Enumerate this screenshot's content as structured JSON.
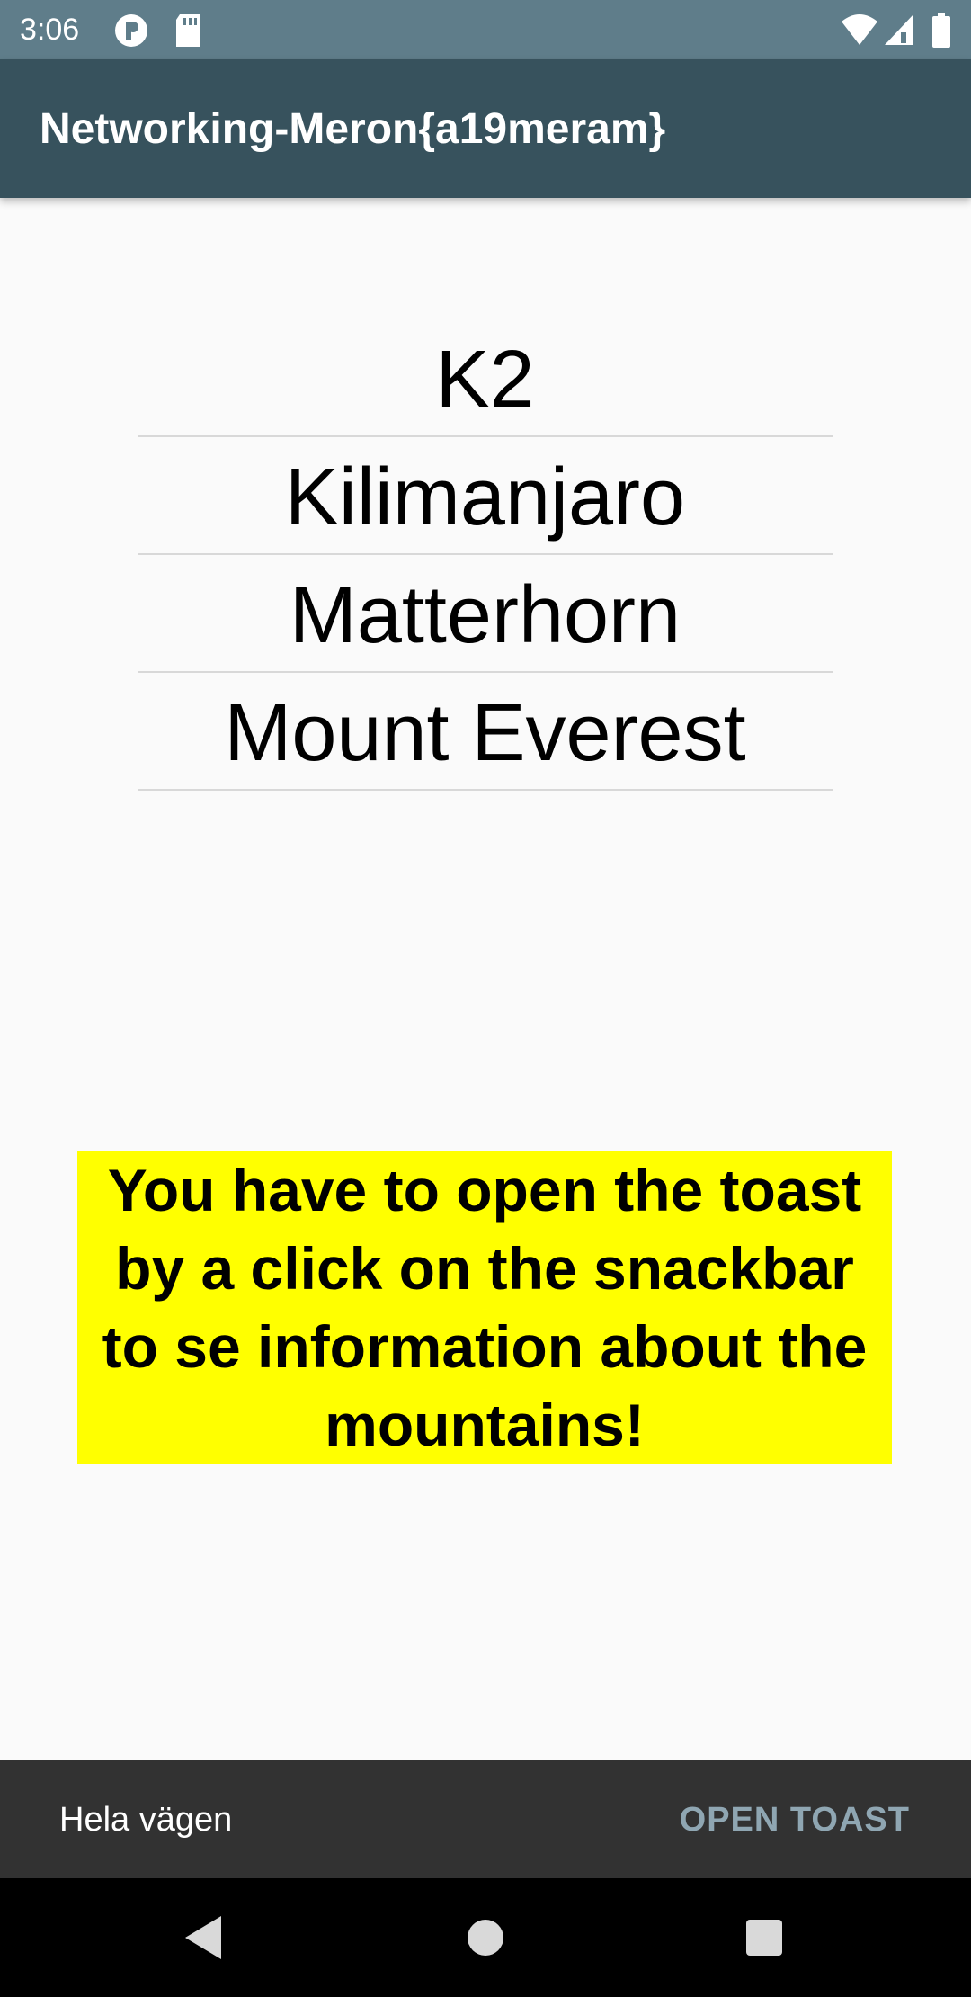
{
  "status": {
    "time": "3:06",
    "icons": [
      "app-notification-icon",
      "sd-card-icon",
      "wifi-icon",
      "signal-icon",
      "battery-icon"
    ]
  },
  "appbar": {
    "title": "Networking-Meron{a19meram}"
  },
  "mountains": [
    {
      "name": "K2"
    },
    {
      "name": "Kilimanjaro"
    },
    {
      "name": "Matterhorn"
    },
    {
      "name": "Mount Everest"
    }
  ],
  "notice": {
    "text": "You have to open the toast by a click on the snackbar to se information about the mountains!",
    "background": "#ffff00"
  },
  "snackbar": {
    "message": "Hela vägen",
    "action": "OPEN TOAST"
  },
  "navbar": {
    "buttons": [
      "back-icon",
      "home-icon",
      "recents-icon"
    ]
  }
}
